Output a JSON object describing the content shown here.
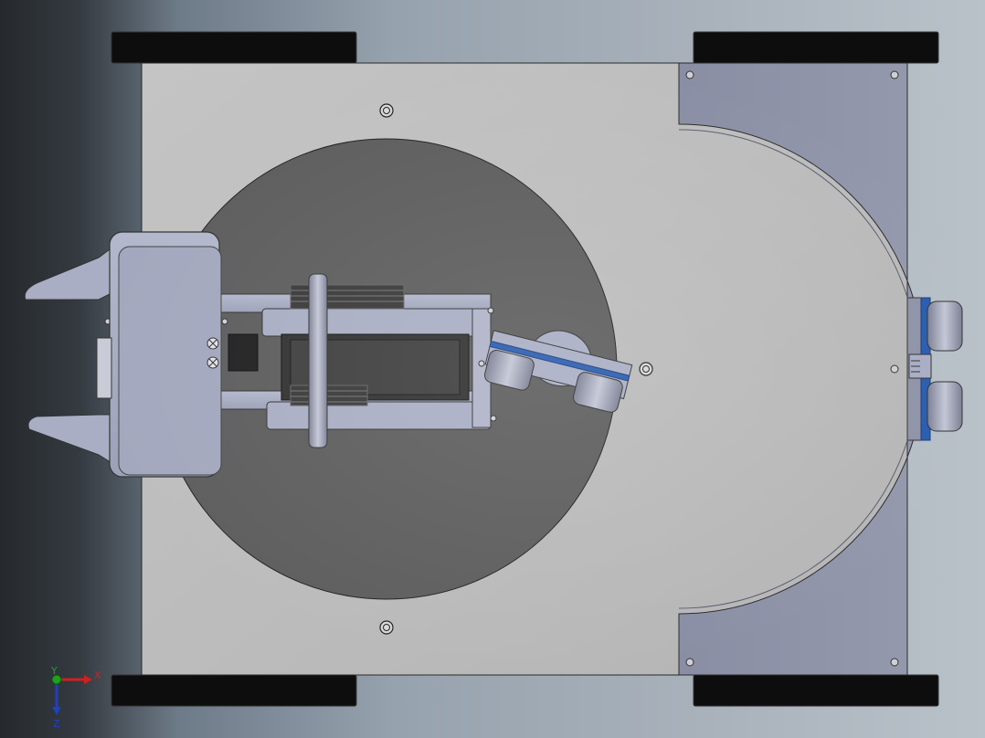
{
  "view": {
    "background_colors": [
      "#25292d",
      "#6d7a87",
      "#b9c1c9"
    ],
    "colors": {
      "base_plate": "#bdbdbd",
      "turntable": "#5e5e5e",
      "wheel": "#0d0d0d",
      "bracket": "#8f93a8",
      "arm_part": "#a9aec4",
      "sensor_ring": "#2a5db0",
      "motor": "#333333"
    }
  },
  "triad": {
    "x_label": "X",
    "y_label": "Y",
    "z_label": "Z",
    "x_color": "#d02020",
    "y_color": "#20a020",
    "z_color": "#2040c0"
  }
}
